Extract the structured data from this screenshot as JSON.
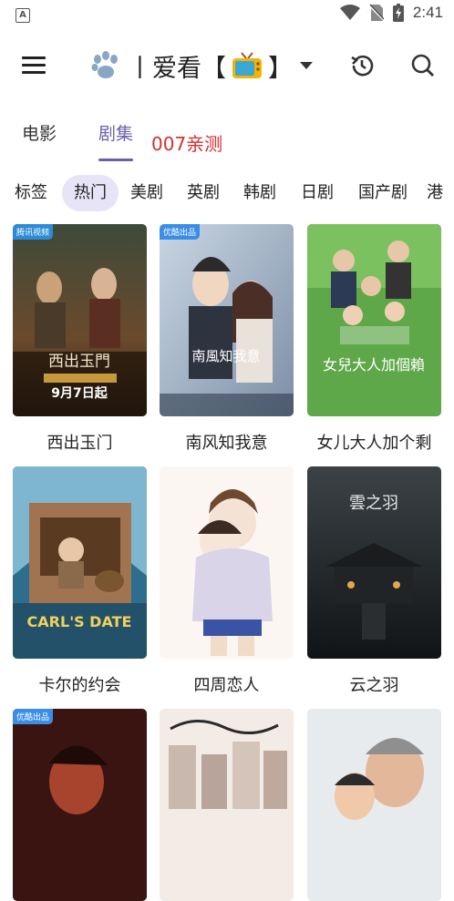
{
  "status_bar": {
    "time": "2:41"
  },
  "app_bar": {
    "title": "丨爱看【",
    "title_close": "】"
  },
  "tabs": [
    {
      "label": "电影"
    },
    {
      "label": "剧集"
    }
  ],
  "tab_note": "007亲测",
  "categories": [
    "标签",
    "热门",
    "美剧",
    "英剧",
    "韩剧",
    "日剧",
    "国产剧",
    "港"
  ],
  "shows": [
    {
      "title": "西出玉门",
      "poster_title": "西出玉門",
      "poster_date": "9月7日起",
      "badge": "腾讯视频"
    },
    {
      "title": "南风知我意",
      "poster_title": "南風知我意",
      "badge": "优酷出品"
    },
    {
      "title": "女儿大人加个剩",
      "poster_title": "女兒大人加個賴",
      "badge": ""
    },
    {
      "title": "卡尔的约会",
      "poster_title": "CARL'S DATE",
      "badge": ""
    },
    {
      "title": "四周恋人",
      "poster_title": "",
      "badge": ""
    },
    {
      "title": "云之羽",
      "poster_title": "雲之羽",
      "badge": ""
    },
    {
      "title": "",
      "poster_title": "",
      "badge": "优酷出品"
    },
    {
      "title": "",
      "poster_title": "",
      "badge": ""
    },
    {
      "title": "",
      "poster_title": "",
      "badge": ""
    }
  ],
  "colors": {
    "accent": "#6a5fa8",
    "chip_active_bg": "#e8e4f7",
    "note_red": "#d32f2f"
  }
}
